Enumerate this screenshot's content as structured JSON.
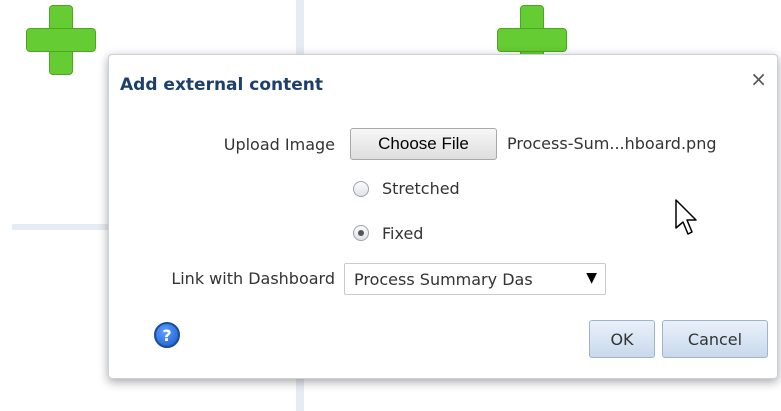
{
  "dialog": {
    "title": "Add external content",
    "close_symbol": "×",
    "upload": {
      "label": "Upload Image",
      "button_label": "Choose File",
      "file_name": "Process-Sum...hboard.png"
    },
    "display_mode": {
      "options": [
        {
          "label": "Stretched",
          "selected": false
        },
        {
          "label": "Fixed",
          "selected": true
        }
      ]
    },
    "link": {
      "label": "Link with Dashboard",
      "selected_value": "Process Summary Das",
      "arrow": "▼"
    },
    "help_symbol": "?",
    "ok_label": "OK",
    "cancel_label": "Cancel"
  },
  "icons": {
    "add": "plus-icon",
    "help": "help-icon",
    "close": "close-icon",
    "cursor": "cursor-icon"
  },
  "colors": {
    "title": "#1c3f6e",
    "plus_green": "#66cc33",
    "button_blue": "#c8d9ec",
    "help_blue": "#1458cc"
  }
}
